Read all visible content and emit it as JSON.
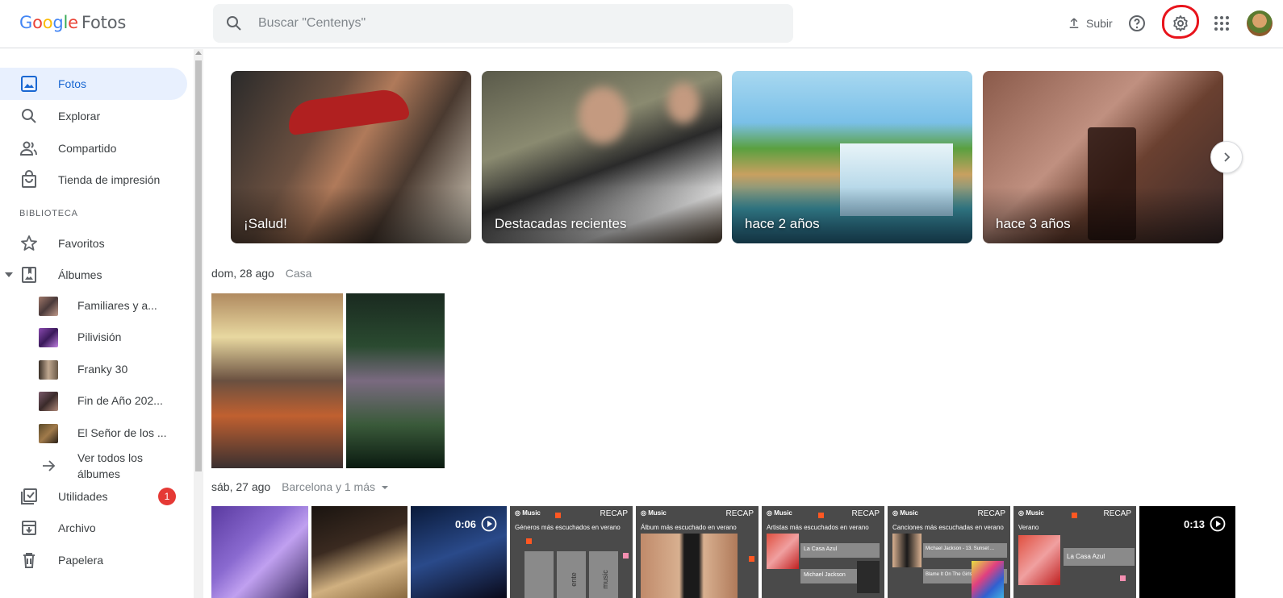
{
  "app": {
    "logo_google": "Google",
    "logo_product": "Fotos"
  },
  "search": {
    "placeholder": "Buscar \"Centenys\""
  },
  "header": {
    "upload_label": "Subir",
    "icons": [
      "upload-icon",
      "help-icon",
      "settings-icon",
      "apps-grid-icon",
      "account-avatar"
    ]
  },
  "sidebar": {
    "items": [
      {
        "label": "Fotos",
        "icon": "photo-icon",
        "active": true
      },
      {
        "label": "Explorar",
        "icon": "search-icon"
      },
      {
        "label": "Compartido",
        "icon": "people-icon"
      },
      {
        "label": "Tienda de impresión",
        "icon": "shopping-bag-icon"
      }
    ],
    "library_heading": "BIBLIOTECA",
    "library": [
      {
        "label": "Favoritos",
        "icon": "star-icon"
      },
      {
        "label": "Álbumes",
        "icon": "album-icon"
      }
    ],
    "albums": [
      {
        "label": "Familiares y a...",
        "color": "#7a5a4a"
      },
      {
        "label": "Pilivisión",
        "color": "#6a3a8a"
      },
      {
        "label": "Franky 30",
        "color": "#5a4a3a"
      },
      {
        "label": "Fin de Año 202...",
        "color": "#6b5a4a"
      },
      {
        "label": "El Señor de los ...",
        "color": "#4a3a2a"
      }
    ],
    "see_all": "Ver todos los álbumes",
    "see_all_line1": "Ver todos los",
    "see_all_line2": "álbumes",
    "bottom": [
      {
        "label": "Utilidades",
        "icon": "utilities-icon",
        "badge": "1"
      },
      {
        "label": "Archivo",
        "icon": "archive-icon"
      },
      {
        "label": "Papelera",
        "icon": "trash-icon"
      }
    ]
  },
  "memories": [
    {
      "label": "¡Salud!"
    },
    {
      "label": "Destacadas recientes"
    },
    {
      "label": "hace 2 años"
    },
    {
      "label": "hace 3 años"
    }
  ],
  "groups": [
    {
      "date": "dom, 28 ago",
      "location": "Casa"
    },
    {
      "date": "sáb, 27 ago",
      "location": "Barcelona y 1 más"
    }
  ],
  "videos": [
    {
      "duration": "0:06"
    },
    {
      "duration": "0:13"
    }
  ],
  "recaps": [
    {
      "brand": "Music",
      "tag": "RECAP",
      "subtitle": "Géneros más escuchados en verano",
      "bars": [
        "",
        "ente",
        "music"
      ]
    },
    {
      "brand": "Music",
      "tag": "RECAP",
      "subtitle": "Álbum más escuchado en verano"
    },
    {
      "brand": "Music",
      "tag": "RECAP",
      "subtitle": "Artistas más escuchados en verano",
      "line1": "La Casa Azul",
      "line2": "Michael Jackson"
    },
    {
      "brand": "Music",
      "tag": "RECAP",
      "subtitle": "Canciones más escuchadas en verano",
      "line1": "Michael Jackson - 13. Sunset ...",
      "line2": "Blame It On The Girls"
    },
    {
      "brand": "Music",
      "tag": "RECAP",
      "subtitle": "Verano",
      "line1": "La Casa Azul"
    }
  ]
}
